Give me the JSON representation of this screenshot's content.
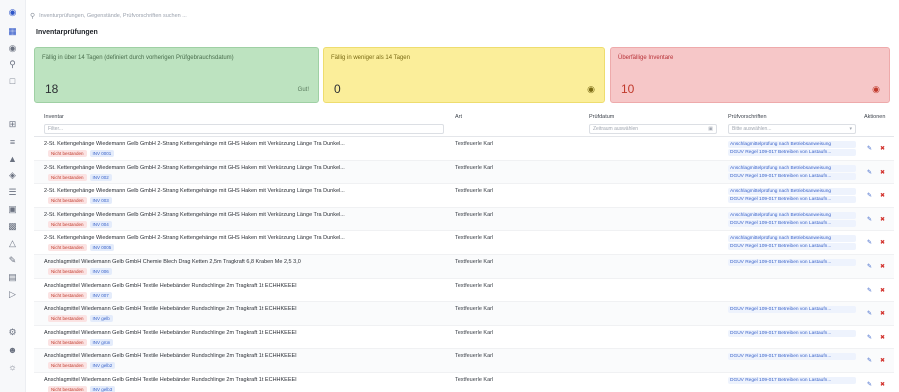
{
  "sidebar": {
    "icons": [
      "logo-icon",
      "inventory-icon",
      "eye-icon",
      "search-icon",
      "box-icon",
      "grid-icon",
      "list-icon",
      "truck-icon",
      "car-icon",
      "document-icon",
      "calendar-icon",
      "chart-icon",
      "org-icon",
      "wrench-icon",
      "stack-icon",
      "tag-icon",
      "settings-icon",
      "user-icon",
      "team-icon"
    ]
  },
  "topbar": {
    "search_placeholder": "Inventurprüfungen, Gegenstände, Prüfvorschriften suchen ..."
  },
  "page": {
    "title": "Inventarprüfungen"
  },
  "cards": [
    {
      "label": "Fällig in über 14 Tagen (definiert durch vorherigen Prüfgebrauchsdatum)",
      "count": "18",
      "right": "Gut!"
    },
    {
      "label": "Fällig in weniger als 14 Tagen",
      "count": "0",
      "right": ""
    },
    {
      "label": "Überfällige Inventare",
      "count": "10",
      "right": ""
    }
  ],
  "table": {
    "headers": {
      "name": "Inventar",
      "art": "Art",
      "date": "Prüfdatum",
      "pv": "Prüfvorschriften",
      "actions": "Aktionen"
    },
    "filters": {
      "name": "Filter...",
      "date": "Zeitraum auswählen",
      "pv": "Bitte auswählen..."
    },
    "rows": [
      {
        "name": "2-St. Kettengehänge Wiedemann Gelb GmbH 2-Strang Kettengehänge mit GHS Haken mit Verkürzung Länge Tra Dunkel...",
        "status": "Nicht bestanden",
        "id": "INV 0001",
        "art": "Textfeuerle Karl",
        "pv": [
          "Anschlagmittelprüfung nach Betriebsanweisung",
          "DGUV Regel 109-017 Betreiben von Lastaufn..."
        ]
      },
      {
        "name": "2-St. Kettengehänge Wiedemann Gelb GmbH 2-Strang Kettengehänge mit GHS Haken mit Verkürzung Länge Tra Dunkel...",
        "status": "Nicht bestanden",
        "id": "INV 002",
        "art": "Textfeuerle Karl",
        "pv": [
          "Anschlagmittelprüfung nach Betriebsanweisung",
          "DGUV Regel 109-017 Betreiben von Lastaufn..."
        ]
      },
      {
        "name": "2-St. Kettengehänge Wiedemann Gelb GmbH 2-Strang Kettengehänge mit GHS Haken mit Verkürzung Länge Tra Dunkel...",
        "status": "Nicht bestanden",
        "id": "INV 003",
        "art": "Textfeuerle Karl",
        "pv": [
          "Anschlagmittelprüfung nach Betriebsanweisung",
          "DGUV Regel 109-017 Betreiben von Lastaufn..."
        ]
      },
      {
        "name": "2-St. Kettengehänge Wiedemann Gelb GmbH 2-Strang Kettengehänge mit GHS Haken mit Verkürzung Länge Tra Dunkel...",
        "status": "Nicht bestanden",
        "id": "INV 004",
        "art": "Textfeuerle Karl",
        "pv": [
          "Anschlagmittelprüfung nach Betriebsanweisung",
          "DGUV Regel 109-017 Betreiben von Lastaufn..."
        ]
      },
      {
        "name": "2-St. Kettengehänge Wiedemann Gelb GmbH 2-Strang Kettengehänge mit GHS Haken mit Verkürzung Länge Tra Dunkel...",
        "status": "Nicht bestanden",
        "id": "INV 0005",
        "art": "Textfeuerle Karl",
        "pv": [
          "Anschlagmittelprüfung nach Betriebsanweisung",
          "DGUV Regel 109-017 Betreiben von Lastaufn..."
        ]
      },
      {
        "name": "Anschlagmittel Wiedemann Gelb GmbH Chemie Blech Drag Ketten 2,5m Tragkraft 6,8 Kraben Me 2,5 3,0",
        "status": "Nicht bestanden",
        "id": "INV 006",
        "art": "Textfeuerle Karl",
        "pv": [
          "DGUV Regel 109-017 Betreiben von Lastaufn..."
        ]
      },
      {
        "name": "Anschlagmittel Wiedemann Gelb GmbH Textile Hebebänder Rundschlinge 2m Tragkraft 1t ECHHKEEEI",
        "status": "Nicht bestanden",
        "id": "INV 007",
        "art": "Textfeuerle Karl",
        "pv": []
      },
      {
        "name": "Anschlagmittel Wiedemann Gelb GmbH Textile Hebebänder Rundschlinge 2m Tragkraft 1t ECHHKEEEI",
        "status": "Nicht bestanden",
        "id": "INV gelb",
        "art": "Textfeuerle Karl",
        "pv": [
          "DGUV Regel 109-017 Betreiben von Lastaufn..."
        ]
      },
      {
        "name": "Anschlagmittel Wiedemann Gelb GmbH Textile Hebebänder Rundschlinge 2m Tragkraft 1t ECHHKEEEI",
        "status": "Nicht bestanden",
        "id": "INV grün",
        "art": "Textfeuerle Karl",
        "pv": [
          "DGUV Regel 109-017 Betreiben von Lastaufn..."
        ]
      },
      {
        "name": "Anschlagmittel Wiedemann Gelb GmbH Textile Hebebänder Rundschlinge 2m Tragkraft 1t ECHHKEEEI",
        "status": "Nicht bestanden",
        "id": "INV gelb2",
        "art": "Textfeuerle Karl",
        "pv": [
          "DGUV Regel 109-017 Betreiben von Lastaufn..."
        ]
      },
      {
        "name": "Anschlagmittel Wiedemann Gelb GmbH Textile Hebebänder Rundschlinge 2m Tragkraft 1t ECHHKEEEI",
        "status": "Nicht bestanden",
        "id": "INV gelb3",
        "art": "Textfeuerle Karl",
        "pv": [
          "DGUV Regel 109-017 Betreiben von Lastaufn..."
        ]
      }
    ]
  },
  "colors": {
    "accent": "#2f56c8",
    "green_card": "#bde3c0",
    "yellow_card": "#fbee9a",
    "red_card": "#f6c7c8",
    "danger": "#d2322d"
  }
}
